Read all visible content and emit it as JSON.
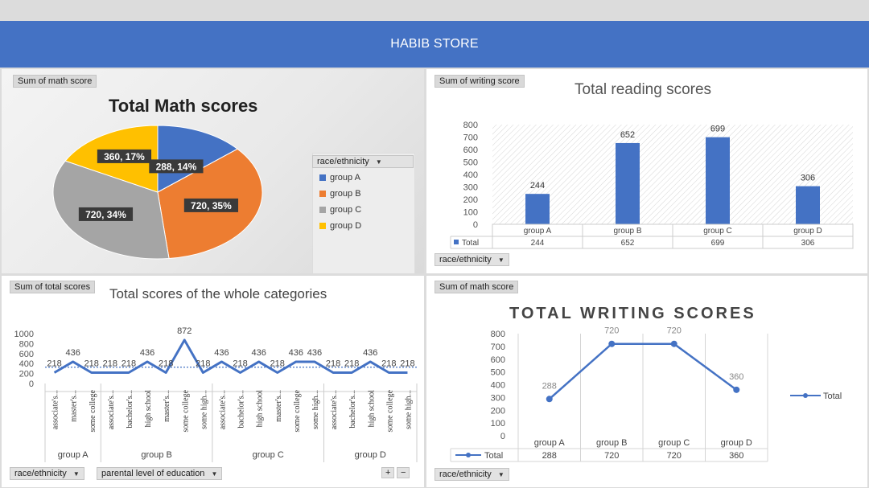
{
  "header": {
    "title": "HABIB STORE"
  },
  "colors": {
    "banner": "#4472c4",
    "blue": "#4472c4",
    "orange": "#ed7d31",
    "gray": "#a5a5a5",
    "yellow": "#ffc000"
  },
  "panel1": {
    "field_label": "Sum of math score",
    "title": "Total Math scores",
    "legend_header": "race/ethnicity",
    "chart_data": {
      "type": "pie",
      "title": "Total Math scores",
      "categories": [
        "group A",
        "group B",
        "group C",
        "group D"
      ],
      "values": [
        288,
        720,
        720,
        360
      ],
      "data_labels": [
        "288, 14%",
        "720, 35%",
        "720, 34%",
        "360, 17%"
      ],
      "legend": "right"
    }
  },
  "panel2": {
    "field_label": "Sum of writing score",
    "title": "Total reading scores",
    "axis_field": "race/ethnicity",
    "table_row_label": "Total",
    "chart_data": {
      "type": "bar",
      "title": "Total reading scores",
      "categories": [
        "group A",
        "group B",
        "group C",
        "group D"
      ],
      "values": [
        244,
        652,
        699,
        306
      ],
      "ylim": [
        0,
        800
      ],
      "yticks": [
        0,
        100,
        200,
        300,
        400,
        500,
        600,
        700,
        800
      ],
      "data_table": true
    }
  },
  "panel3": {
    "field_label": "Sum of total scores",
    "title": "Total scores of the whole categories",
    "axis_field_1": "race/ethnicity",
    "axis_field_2": "parental level of education",
    "plus": "+",
    "minus": "−",
    "chart_data": {
      "type": "line",
      "title": "Total scores of the whole categories",
      "groups": [
        "group A",
        "group B",
        "group C",
        "group D"
      ],
      "group_sizes": [
        3,
        6,
        6,
        5
      ],
      "categories": [
        "associate's...",
        "master's...",
        "some college",
        "associate's...",
        "bachelor's...",
        "high school",
        "master's...",
        "some college",
        "some high...",
        "associate's...",
        "bachelor's...",
        "high school",
        "master's...",
        "some college",
        "some high...",
        "associate's...",
        "bachelor's...",
        "high school",
        "some college",
        "some high..."
      ],
      "values": [
        218,
        436,
        218,
        218,
        218,
        436,
        218,
        872,
        218,
        436,
        218,
        436,
        218,
        436,
        436,
        218,
        218,
        436,
        218,
        218
      ],
      "ylim": [
        0,
        1000
      ],
      "yticks": [
        0,
        200,
        400,
        600,
        800,
        1000
      ],
      "avg_line": true
    }
  },
  "panel4": {
    "field_label": "Sum of math score",
    "title": "TOTAL WRITING SCORES",
    "axis_field": "race/ethnicity",
    "table_row_label": "Total",
    "legend_label": "Total",
    "chart_data": {
      "type": "line",
      "title": "TOTAL WRITING SCORES",
      "categories": [
        "group A",
        "group B",
        "group C",
        "group D"
      ],
      "values": [
        288,
        720,
        720,
        360
      ],
      "ylim": [
        0,
        800
      ],
      "yticks": [
        0,
        100,
        200,
        300,
        400,
        500,
        600,
        700,
        800
      ],
      "legend": "right",
      "data_table": true
    }
  }
}
